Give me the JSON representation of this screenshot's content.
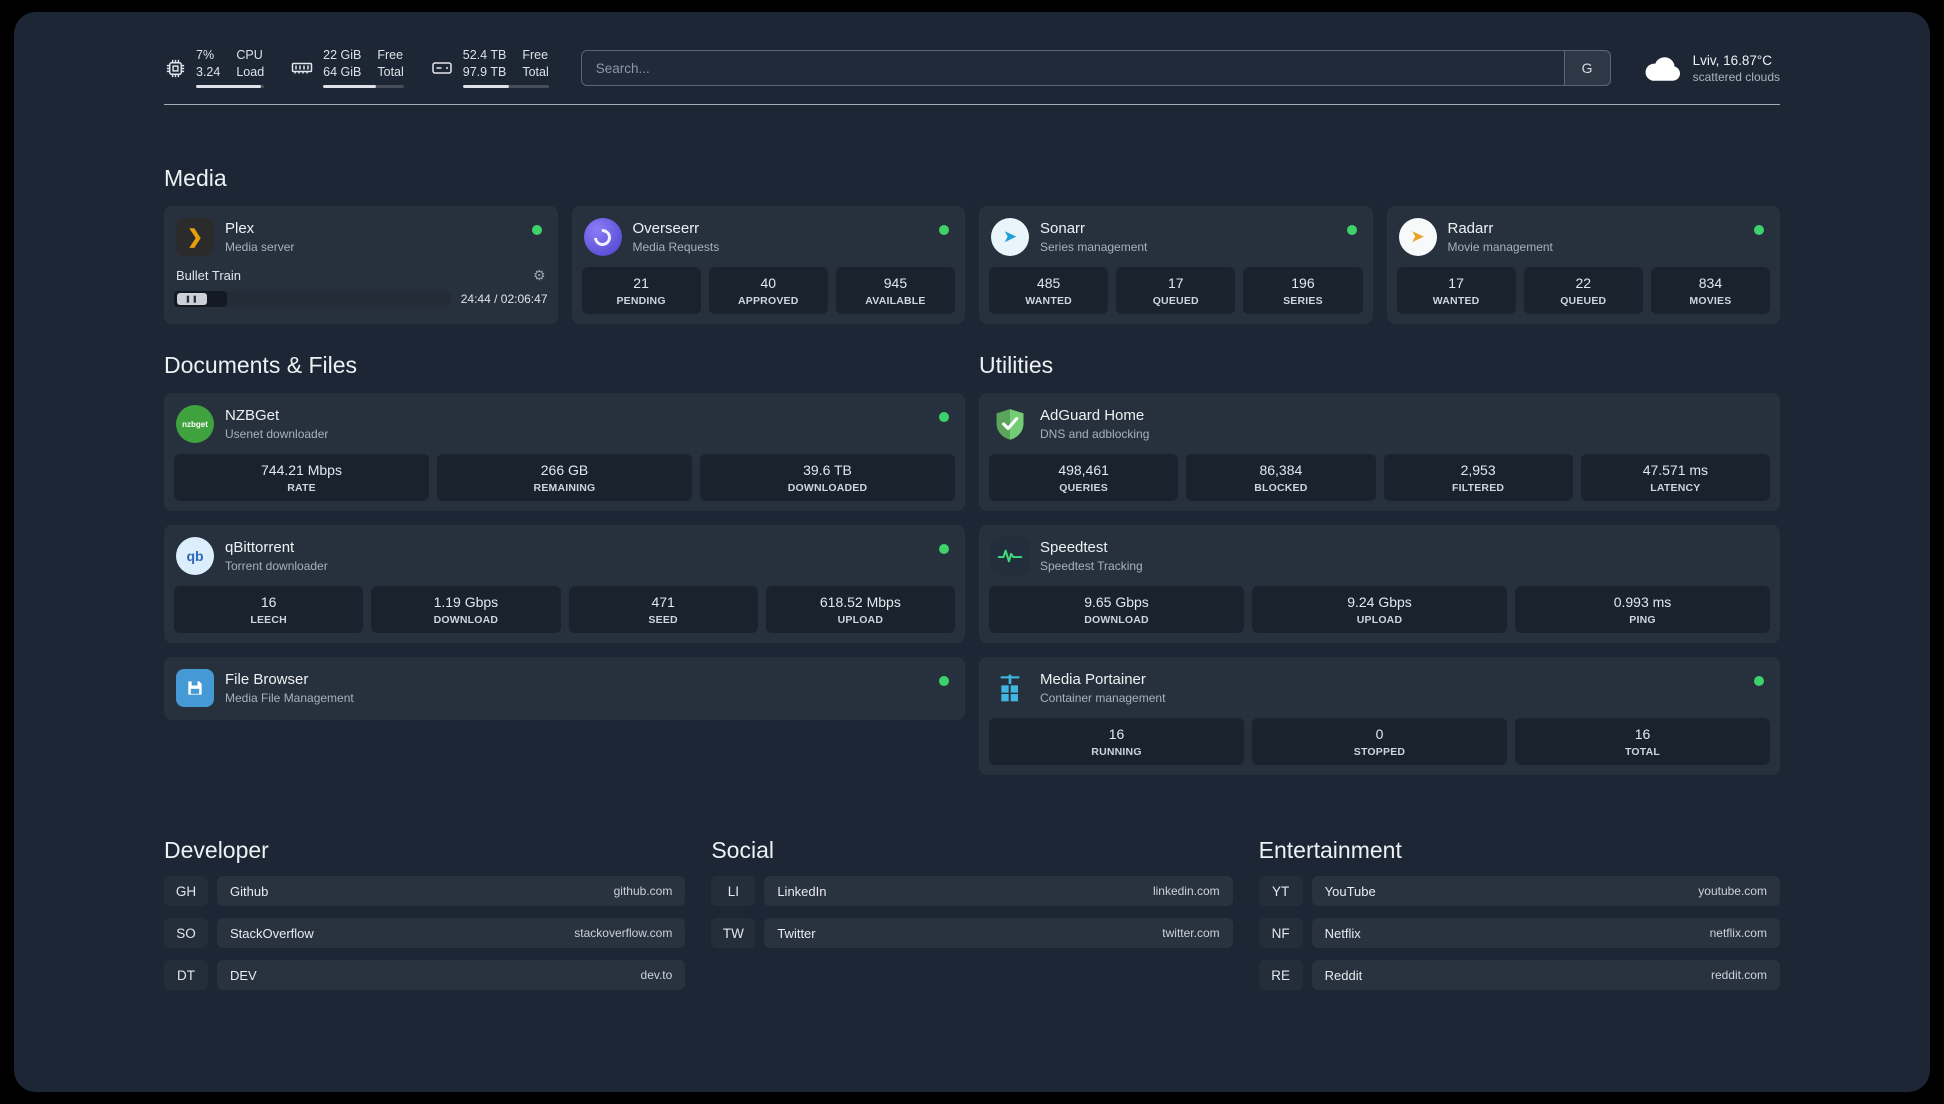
{
  "colors": {
    "background": "#1c2634",
    "card": "rgba(255,255,255,0.05)",
    "status_online": "#3ed36a",
    "plex_accent": "#e5a00d",
    "adguard_green": "#62b263",
    "speedtest_green": "#41d97c"
  },
  "topbar": {
    "cpu": {
      "value_top": "7%",
      "value_bottom": "3.24",
      "label_top": "CPU",
      "label_bottom": "Load",
      "bar_percent": 96
    },
    "ram": {
      "value_top": "22 GiB",
      "value_bottom": "64 GiB",
      "label_top": "Free",
      "label_bottom": "Total",
      "bar_percent": 66
    },
    "disk": {
      "value_top": "52.4 TB",
      "value_bottom": "97.9 TB",
      "label_top": "Free",
      "label_bottom": "Total",
      "bar_percent": 54
    },
    "search": {
      "placeholder": "Search...",
      "provider_letter": "G"
    },
    "weather": {
      "location": "Lviv, 16.87°C",
      "condition": "scattered clouds"
    }
  },
  "media": {
    "title": "Media",
    "plex": {
      "name": "Plex",
      "desc": "Media server",
      "icon_glyph": "❯",
      "now_playing": "Bullet Train",
      "gear_glyph": "⚙",
      "pause_glyph": "❚❚",
      "time": "24:44 / 02:06:47",
      "progress_percent": 19
    },
    "overseerr": {
      "name": "Overseerr",
      "desc": "Media Requests",
      "stats": [
        {
          "value": "21",
          "label": "PENDING"
        },
        {
          "value": "40",
          "label": "APPROVED"
        },
        {
          "value": "945",
          "label": "AVAILABLE"
        }
      ]
    },
    "sonarr": {
      "name": "Sonarr",
      "desc": "Series management",
      "icon_glyph": "➤",
      "stats": [
        {
          "value": "485",
          "label": "WANTED"
        },
        {
          "value": "17",
          "label": "QUEUED"
        },
        {
          "value": "196",
          "label": "SERIES"
        }
      ]
    },
    "radarr": {
      "name": "Radarr",
      "desc": "Movie management",
      "icon_glyph": "➤",
      "stats": [
        {
          "value": "17",
          "label": "WANTED"
        },
        {
          "value": "22",
          "label": "QUEUED"
        },
        {
          "value": "834",
          "label": "MOVIES"
        }
      ]
    }
  },
  "documents": {
    "title": "Documents & Files",
    "nzbget": {
      "name": "NZBGet",
      "desc": "Usenet downloader",
      "icon_text": "nzbget",
      "stats": [
        {
          "value": "744.21 Mbps",
          "label": "RATE"
        },
        {
          "value": "266 GB",
          "label": "REMAINING"
        },
        {
          "value": "39.6 TB",
          "label": "DOWNLOADED"
        }
      ]
    },
    "qbittorrent": {
      "name": "qBittorrent",
      "desc": "Torrent downloader",
      "icon_text": "qb",
      "stats": [
        {
          "value": "16",
          "label": "LEECH"
        },
        {
          "value": "1.19 Gbps",
          "label": "DOWNLOAD"
        },
        {
          "value": "471",
          "label": "SEED"
        },
        {
          "value": "618.52 Mbps",
          "label": "UPLOAD"
        }
      ]
    },
    "filebrowser": {
      "name": "File Browser",
      "desc": "Media File Management"
    }
  },
  "utilities": {
    "title": "Utilities",
    "adguard": {
      "name": "AdGuard Home",
      "desc": "DNS and adblocking",
      "stats": [
        {
          "value": "498,461",
          "label": "QUERIES"
        },
        {
          "value": "86,384",
          "label": "BLOCKED"
        },
        {
          "value": "2,953",
          "label": "FILTERED"
        },
        {
          "value": "47.571 ms",
          "label": "LATENCY"
        }
      ]
    },
    "speedtest": {
      "name": "Speedtest",
      "desc": "Speedtest Tracking",
      "stats": [
        {
          "value": "9.65 Gbps",
          "label": "DOWNLOAD"
        },
        {
          "value": "9.24 Gbps",
          "label": "UPLOAD"
        },
        {
          "value": "0.993 ms",
          "label": "PING"
        }
      ]
    },
    "portainer": {
      "name": "Media Portainer",
      "desc": "Container management",
      "stats": [
        {
          "value": "16",
          "label": "RUNNING"
        },
        {
          "value": "0",
          "label": "STOPPED"
        },
        {
          "value": "16",
          "label": "TOTAL"
        }
      ]
    }
  },
  "bookmarks": {
    "developer": {
      "title": "Developer",
      "items": [
        {
          "abbr": "GH",
          "name": "Github",
          "url": "github.com"
        },
        {
          "abbr": "SO",
          "name": "StackOverflow",
          "url": "stackoverflow.com"
        },
        {
          "abbr": "DT",
          "name": "DEV",
          "url": "dev.to"
        }
      ]
    },
    "social": {
      "title": "Social",
      "items": [
        {
          "abbr": "LI",
          "name": "LinkedIn",
          "url": "linkedin.com"
        },
        {
          "abbr": "TW",
          "name": "Twitter",
          "url": "twitter.com"
        }
      ]
    },
    "entertainment": {
      "title": "Entertainment",
      "items": [
        {
          "abbr": "YT",
          "name": "YouTube",
          "url": "youtube.com"
        },
        {
          "abbr": "NF",
          "name": "Netflix",
          "url": "netflix.com"
        },
        {
          "abbr": "RE",
          "name": "Reddit",
          "url": "reddit.com"
        }
      ]
    }
  }
}
